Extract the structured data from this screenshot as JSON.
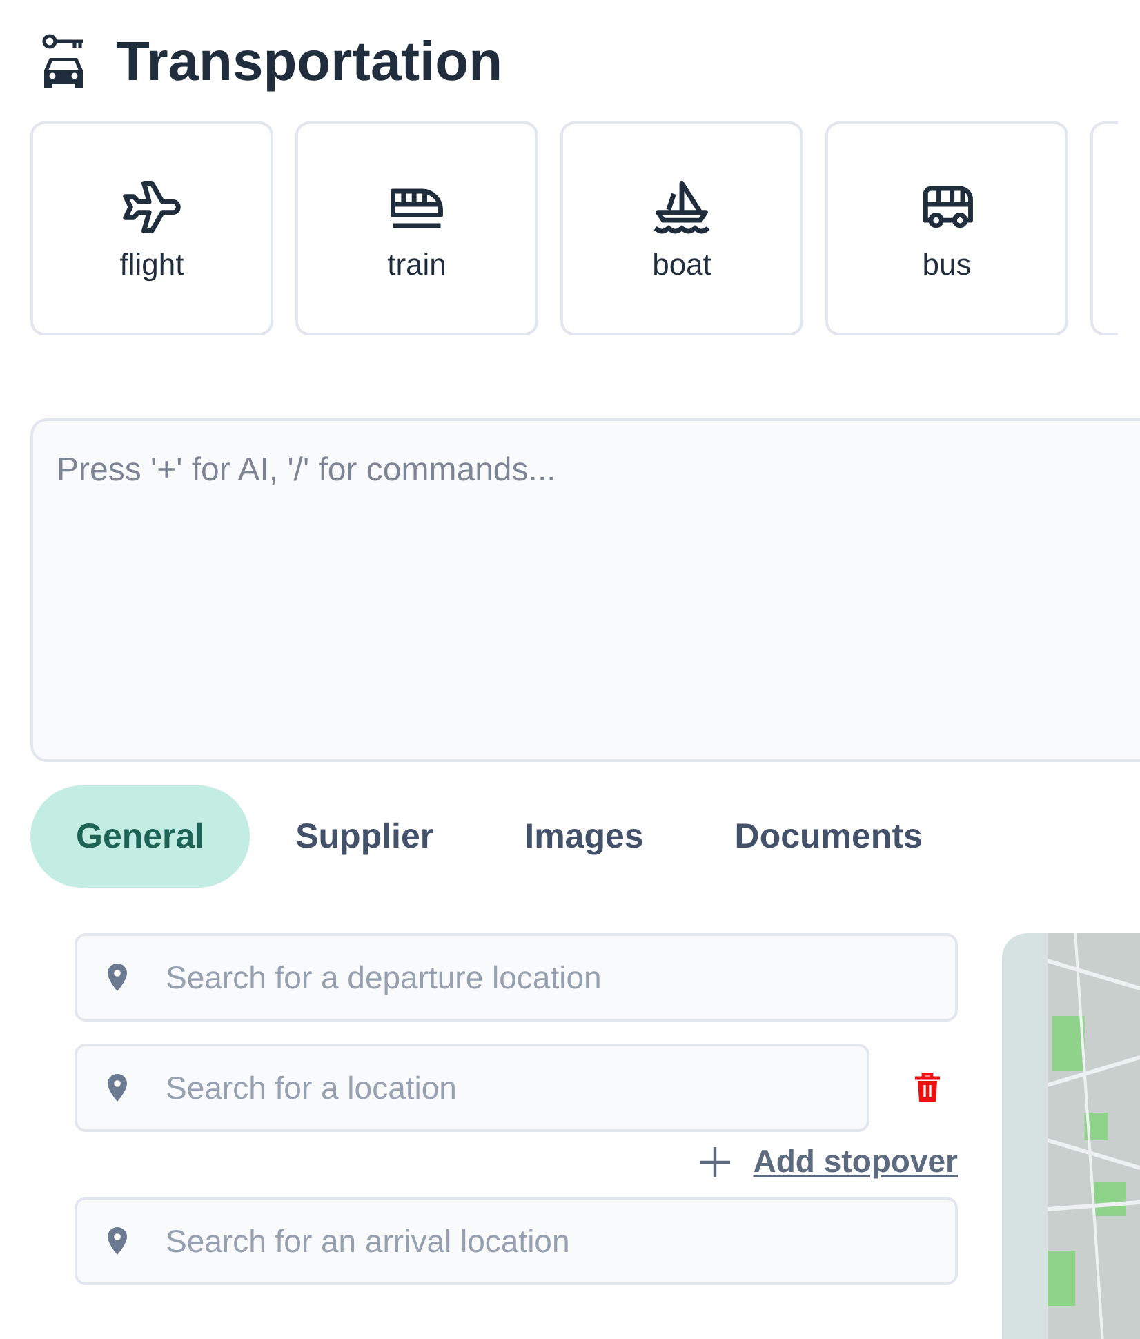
{
  "header": {
    "title": "Transportation"
  },
  "modes": [
    {
      "kind": "flight",
      "label": "flight"
    },
    {
      "kind": "train",
      "label": "train"
    },
    {
      "kind": "boat",
      "label": "boat"
    },
    {
      "kind": "bus",
      "label": "bus"
    }
  ],
  "editor": {
    "placeholder": "Press '+' for AI, '/' for commands..."
  },
  "tabs": [
    {
      "label": "General",
      "selected": true
    },
    {
      "label": "Supplier",
      "selected": false
    },
    {
      "label": "Images",
      "selected": false
    },
    {
      "label": "Documents",
      "selected": false
    }
  ],
  "locations": [
    {
      "kind": "field",
      "placeholder": "Search for a departure location",
      "removable": false
    },
    {
      "kind": "field",
      "placeholder": "Search for a location",
      "removable": true
    },
    {
      "kind": "add",
      "label": "Add stopover"
    },
    {
      "kind": "field",
      "placeholder": "Search for an arrival location",
      "removable": false
    }
  ]
}
